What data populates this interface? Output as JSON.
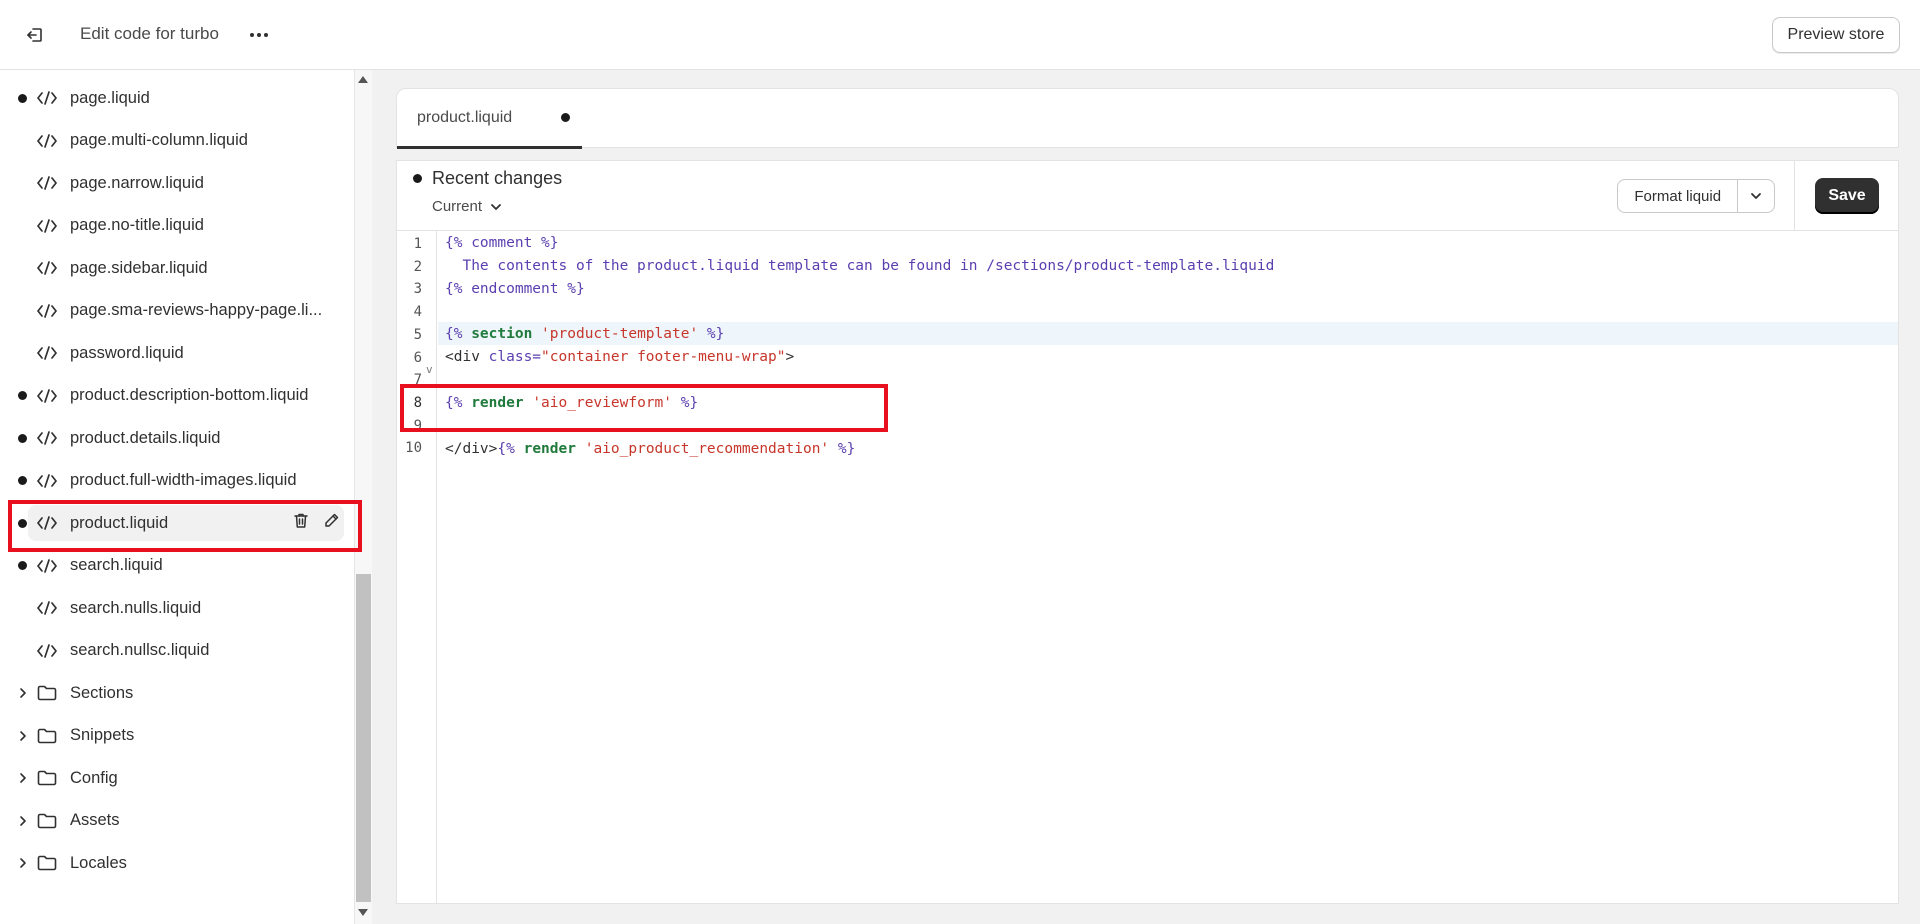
{
  "topbar": {
    "title": "Edit code for turbo",
    "preview_label": "Preview store"
  },
  "sidebar": {
    "items": [
      {
        "label": "page.liquid",
        "modified": true
      },
      {
        "label": "page.multi-column.liquid",
        "modified": false
      },
      {
        "label": "page.narrow.liquid",
        "modified": false
      },
      {
        "label": "page.no-title.liquid",
        "modified": false
      },
      {
        "label": "page.sidebar.liquid",
        "modified": false
      },
      {
        "label": "page.sma-reviews-happy-page.li...",
        "modified": false
      },
      {
        "label": "password.liquid",
        "modified": false
      },
      {
        "label": "product.description-bottom.liquid",
        "modified": true
      },
      {
        "label": "product.details.liquid",
        "modified": true
      },
      {
        "label": "product.full-width-images.liquid",
        "modified": true
      },
      {
        "label": "product.liquid",
        "modified": true,
        "selected": true
      },
      {
        "label": "search.liquid",
        "modified": true
      },
      {
        "label": "search.nulls.liquid",
        "modified": false
      },
      {
        "label": "search.nullsc.liquid",
        "modified": false
      }
    ],
    "folders": [
      "Sections",
      "Snippets",
      "Config",
      "Assets",
      "Locales"
    ]
  },
  "editor": {
    "tab_label": "product.liquid",
    "recent_changes": "Recent changes",
    "version": "Current",
    "format_label": "Format liquid",
    "save_label": "Save",
    "line_numbers": [
      "1",
      "2",
      "3",
      "4",
      "5",
      "6",
      "7",
      "8",
      "9",
      "10"
    ],
    "code": {
      "l1": "{% comment %}",
      "l2": "  The contents of the product.liquid template can be found in /sections/product-template.liquid",
      "l3": "{% endcomment %}",
      "l5_open": "{% ",
      "l5_kw": "section",
      "l5_str": "'product-template'",
      "l5_close": " %}",
      "l6_tag": "<div ",
      "l6_attr": "class=",
      "l6_val": "\"container footer-menu-wrap\"",
      "l6_end": ">",
      "l8_open": "{% ",
      "l8_kw": "render",
      "l8_str": "'aio_reviewform'",
      "l8_close": " %}",
      "l10_tag": "</div>",
      "l10_open": "{% ",
      "l10_kw": "render",
      "l10_str": "'aio_product_recommendation'",
      "l10_close": " %}"
    }
  },
  "colors": {
    "highlight": "#e8101f",
    "save_button": "#303030"
  }
}
